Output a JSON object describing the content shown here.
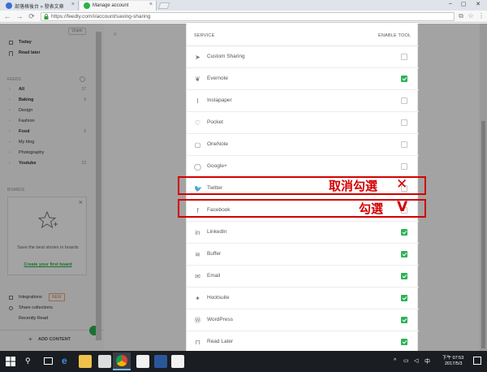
{
  "browser": {
    "tabs": [
      {
        "title": "部落格後台 » 發表文章",
        "active": false
      },
      {
        "title": "Manage account",
        "active": true
      }
    ],
    "url": "https://feedly.com/i/account/saving-sharing"
  },
  "sidebar": {
    "unpin_label": "Unpin",
    "top_items": [
      {
        "label": "Today"
      },
      {
        "label": "Read later"
      }
    ],
    "feeds_heading": "FEEDS",
    "feeds": [
      {
        "label": "All",
        "count": "37",
        "bold": true
      },
      {
        "label": "Baking",
        "count": "9",
        "bold": true
      },
      {
        "label": "Design",
        "count": "",
        "bold": false
      },
      {
        "label": "Fashion",
        "count": "",
        "bold": false
      },
      {
        "label": "Food",
        "count": "9",
        "bold": true
      },
      {
        "label": "My blog",
        "count": "",
        "bold": false
      },
      {
        "label": "Photography",
        "count": "",
        "bold": false
      },
      {
        "label": "Youtube",
        "count": "23",
        "bold": true
      }
    ],
    "boards_heading": "BOARDS",
    "boards_promo_text": "Save the best stories in boards",
    "boards_promo_link": "Create your first board",
    "integrations_label": "Integrations",
    "new_badge": "NEW",
    "share_collections_label": "Share collections",
    "recently_read_label": "Recently Read",
    "add_content_label": "ADD CONTENT"
  },
  "modal": {
    "close_glyph": "×",
    "header_service": "SERVICE",
    "header_enable": "ENABLE TOOL",
    "services": [
      {
        "name": "Custom Sharing",
        "icon": "send-icon",
        "glyph": "➤",
        "enabled": false
      },
      {
        "name": "Evernote",
        "icon": "evernote-icon",
        "glyph": "❦",
        "enabled": true
      },
      {
        "name": "Instapaper",
        "icon": "instapaper-icon",
        "glyph": "I",
        "enabled": false
      },
      {
        "name": "Pocket",
        "icon": "pocket-icon",
        "glyph": "♡",
        "enabled": false
      },
      {
        "name": "OneNote",
        "icon": "onenote-icon",
        "glyph": "▢",
        "enabled": false
      },
      {
        "name": "Google+",
        "icon": "googleplus-icon",
        "glyph": "◯",
        "enabled": false
      },
      {
        "name": "Twitter",
        "icon": "twitter-icon",
        "glyph": "🐦",
        "enabled": false
      },
      {
        "name": "Facebook",
        "icon": "facebook-icon",
        "glyph": "f",
        "enabled": false
      },
      {
        "name": "LinkedIn",
        "icon": "linkedin-icon",
        "glyph": "in",
        "enabled": true
      },
      {
        "name": "Buffer",
        "icon": "buffer-icon",
        "glyph": "≋",
        "enabled": true
      },
      {
        "name": "Email",
        "icon": "email-icon",
        "glyph": "✉",
        "enabled": true
      },
      {
        "name": "Hootsuite",
        "icon": "hootsuite-icon",
        "glyph": "✦",
        "enabled": true
      },
      {
        "name": "WordPress",
        "icon": "wordpress-icon",
        "glyph": "Ⓦ",
        "enabled": true
      },
      {
        "name": "Read Later",
        "icon": "bookmark-icon",
        "glyph": "⊓",
        "enabled": true
      }
    ]
  },
  "annotations": {
    "twitter_note": "取消勾選",
    "twitter_mark": "✕",
    "facebook_note": "勾選",
    "facebook_mark": "V"
  },
  "taskbar": {
    "time_line1": "下午 07:53",
    "time_line2": "2017/5/3"
  }
}
